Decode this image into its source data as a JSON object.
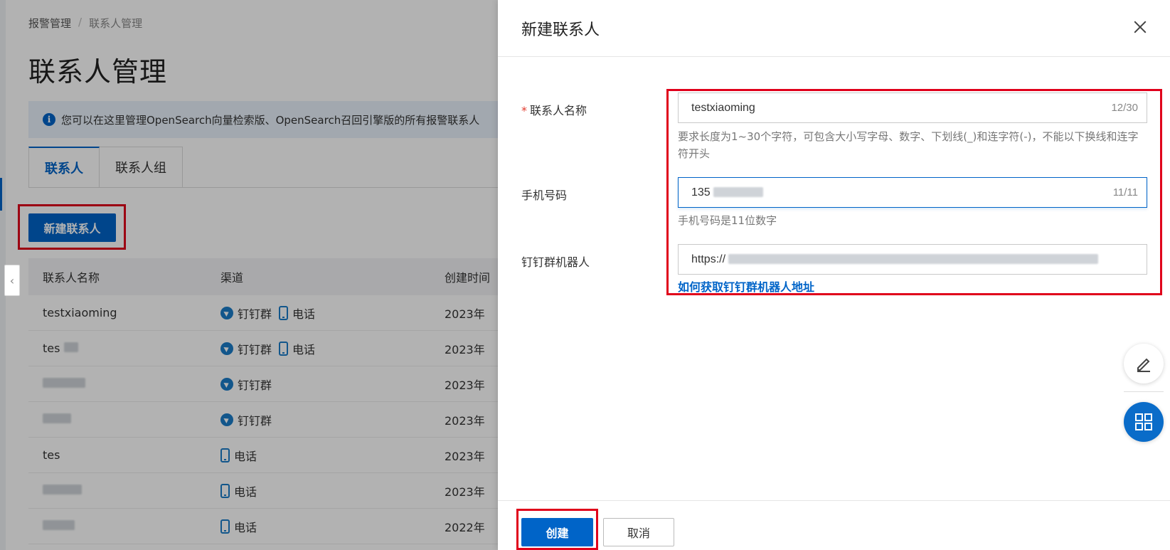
{
  "background": {
    "breadcrumb": [
      "报警管理",
      "联系人管理"
    ],
    "breadcrumb_sep": "/",
    "page_title": "联系人管理",
    "notice_text": "您可以在这里管理OpenSearch向量检索版、OpenSearch召回引擎版的所有报警联系人",
    "notice_icon": "info-icon",
    "tabs": [
      "联系人",
      "联系人组"
    ],
    "new_contact_button": "新建联系人",
    "table": {
      "headers": [
        "联系人名称",
        "渠道",
        "创建时间"
      ],
      "rows": [
        {
          "name": "testxiaoming",
          "channels": [
            "钉钉群",
            "电话"
          ],
          "created": "2023年"
        },
        {
          "name": "tes",
          "channels": [
            "钉钉群",
            "电话"
          ],
          "created": "2023年"
        },
        {
          "name": "",
          "channels": [
            "钉钉群"
          ],
          "created": "2023年"
        },
        {
          "name": "",
          "channels": [
            "钉钉群"
          ],
          "created": "2023年"
        },
        {
          "name": "tes",
          "channels": [
            "电话"
          ],
          "created": "2023年"
        },
        {
          "name": "",
          "channels": [
            "电话"
          ],
          "created": "2023年"
        },
        {
          "name": "",
          "channels": [
            "电话"
          ],
          "created": "2022年"
        }
      ]
    }
  },
  "drawer": {
    "title": "新建联系人",
    "close_icon": "close-icon",
    "fields": {
      "name": {
        "required_mark": "*",
        "label": "联系人名称",
        "value": "testxiaoming",
        "count": "12/30",
        "help": "要求长度为1~30个字符，可包含大小写字母、数字、下划线(_)和连字符(-)，不能以下换线和连字符开头"
      },
      "phone": {
        "label": "手机号码",
        "value": "135",
        "count": "11/11",
        "help": "手机号码是11位数字"
      },
      "dingtalk": {
        "label": "钉钉群机器人",
        "value": "https://",
        "link": "如何获取钉钉群机器人地址"
      }
    },
    "buttons": {
      "create": "创建",
      "cancel": "取消"
    },
    "float_buttons": [
      "edit-icon",
      "grid-icon"
    ]
  },
  "colors": {
    "primary": "#0064c8",
    "highlight_box": "#e0001b",
    "required": "#e23b2e"
  }
}
